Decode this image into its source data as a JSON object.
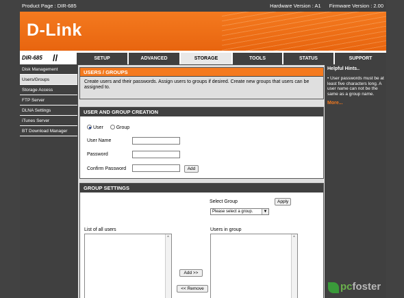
{
  "top_bar": {
    "product": "Product Page :  DIR-685",
    "hardware": "Hardware Version : A1",
    "firmware": "Firmware Version : 2.00"
  },
  "brand": {
    "logo": "D-Link"
  },
  "nav": {
    "model": "DIR-685",
    "tabs": [
      "SETUP",
      "ADVANCED",
      "STORAGE",
      "TOOLS",
      "STATUS",
      "SUPPORT"
    ],
    "active_tab": "STORAGE"
  },
  "sidebar": {
    "items": [
      "Disk Management",
      "Users/Groups",
      "Storage Access",
      "FTP Server",
      "DLNA Settings",
      "iTunes Server",
      "BT Download Manager"
    ],
    "active": "Users/Groups"
  },
  "intro": {
    "title": "USERS / GROUPS",
    "text": "Create users and their passwords. Assign users to groups if desired. Create new groups that users can be assigned to."
  },
  "creation": {
    "title": "USER AND GROUP CREATION",
    "radio_user": "User",
    "radio_group": "Group",
    "user_name_label": "User Name",
    "password_label": "Password",
    "confirm_label": "Confirm Password",
    "add_button": "Add"
  },
  "group_settings": {
    "title": "GROUP SETTINGS",
    "select_group_label": "Select Group",
    "select_placeholder": "Please select a group.",
    "apply_button": "Apply",
    "all_users_label": "List of all users",
    "users_in_group_label": "Users in group",
    "add_button": "Add >>",
    "remove_button": "<< Remove"
  },
  "hints": {
    "title": "Helpful Hints..",
    "items": [
      "User passwords must be at least five characters long. A user name can not be the same as a group name."
    ],
    "more": "More..."
  },
  "watermark": {
    "prefix": "pc",
    "suffix": "foster"
  },
  "colors": {
    "accent": "#f47a1f",
    "dark": "#404040",
    "panel": "#dfdfdf"
  }
}
